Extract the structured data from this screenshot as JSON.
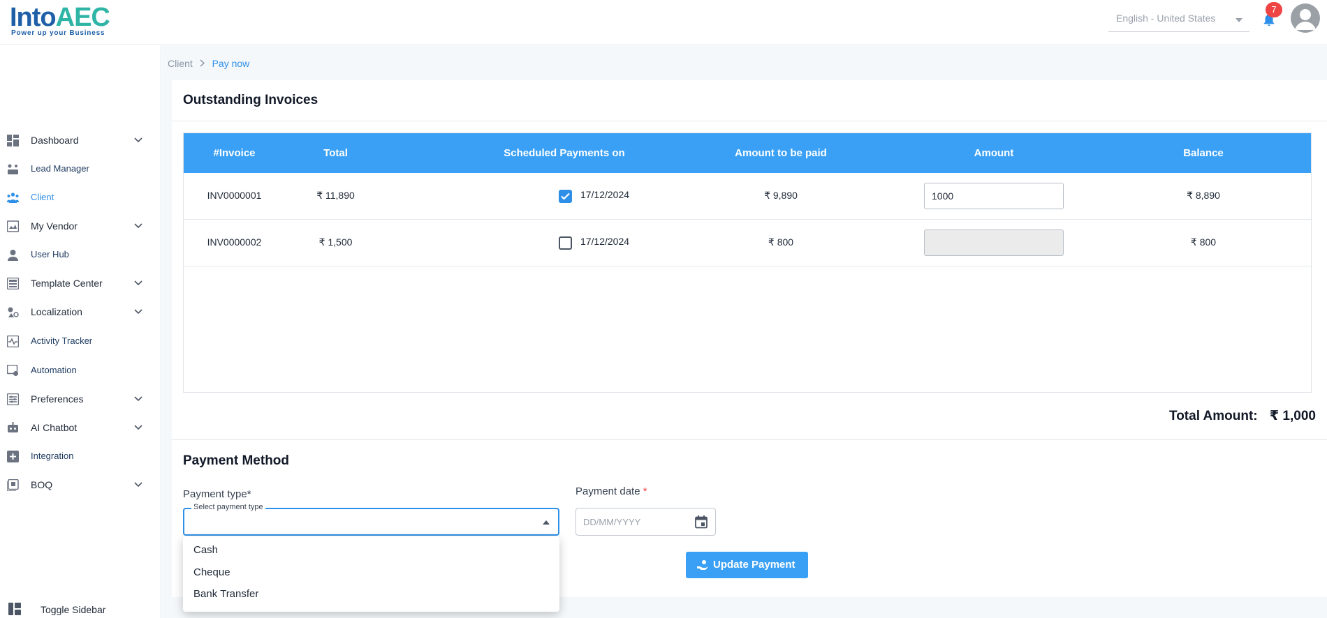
{
  "brand": {
    "name_main": "Into",
    "name_accent": "AEC",
    "tagline": "Power up your Business"
  },
  "header": {
    "language": "English - United States",
    "notification_count": "7"
  },
  "sidebar": {
    "items": [
      {
        "label": "Dashboard",
        "icon": "dashboard-icon",
        "has_chevron": true
      },
      {
        "label": "Lead Manager",
        "icon": "lead-manager-icon",
        "has_chevron": false
      },
      {
        "label": "Client",
        "icon": "client-icon",
        "has_chevron": false,
        "active": true
      },
      {
        "label": "My Vendor",
        "icon": "vendor-icon",
        "has_chevron": true
      },
      {
        "label": "User Hub",
        "icon": "user-icon",
        "has_chevron": false
      },
      {
        "label": "Template Center",
        "icon": "template-icon",
        "has_chevron": true
      },
      {
        "label": "Localization",
        "icon": "localization-icon",
        "has_chevron": true
      },
      {
        "label": "Activity Tracker",
        "icon": "activity-icon",
        "has_chevron": false
      },
      {
        "label": "Automation",
        "icon": "automation-icon",
        "has_chevron": false
      },
      {
        "label": "Preferences",
        "icon": "preferences-icon",
        "has_chevron": true
      },
      {
        "label": "AI Chatbot",
        "icon": "chatbot-icon",
        "has_chevron": true
      },
      {
        "label": "Integration",
        "icon": "integration-icon",
        "has_chevron": false
      },
      {
        "label": "BOQ",
        "icon": "boq-icon",
        "has_chevron": true
      }
    ],
    "toggle_label": "Toggle Sidebar"
  },
  "breadcrumb": {
    "parent": "Client",
    "current": "Pay now"
  },
  "invoices": {
    "title": "Outstanding Invoices",
    "columns": [
      "#Invoice",
      "Total",
      "Scheduled Payments on",
      "Amount to be paid",
      "Amount",
      "Balance"
    ],
    "rows": [
      {
        "invoice": "INV0000001",
        "total": "₹ 11,890",
        "checked": true,
        "scheduled": "17/12/2024",
        "to_pay": "₹ 9,890",
        "amount": "1000",
        "balance": "₹ 8,890"
      },
      {
        "invoice": "INV0000002",
        "total": "₹ 1,500",
        "checked": false,
        "scheduled": "17/12/2024",
        "to_pay": "₹ 800",
        "amount": "",
        "balance": "₹ 800"
      }
    ],
    "total_label": "Total Amount:",
    "total_value": "₹ 1,000"
  },
  "payment": {
    "title": "Payment Method",
    "type_label": "Payment type*",
    "type_placeholder": "Select payment type",
    "date_label": "Payment date",
    "date_required": "*",
    "date_placeholder": "DD/MM/YYYY",
    "update_button": "Update Payment",
    "options": [
      "Cash",
      "Cheque",
      "Bank Transfer"
    ]
  },
  "colors": {
    "primary": "#3aa0f5",
    "accent": "#2e8fe8",
    "badge": "#ef4444",
    "brand": "#1e5fa8"
  }
}
